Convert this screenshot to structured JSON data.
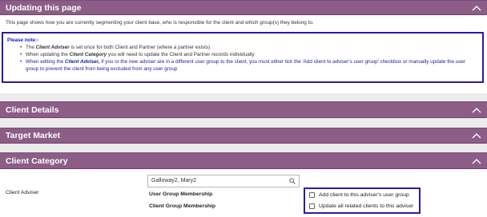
{
  "panels": {
    "updating": {
      "title": "Updating this page"
    },
    "client_details": {
      "title": "Client Details"
    },
    "target_market": {
      "title": "Target Market"
    },
    "client_category": {
      "title": "Client Category"
    }
  },
  "intro_text": "This page shows how you are currently segmenting your client base, who is responsible for the client and which group(s) they belong to.",
  "note": {
    "title": "Please note:-",
    "item1_pre": "The ",
    "item1_em": "Client Adviser",
    "item1_post": " is set once for both Client and Partner (where a partner exists)",
    "item2_pre": "When updating the ",
    "item2_em": "Client Category",
    "item2_post": " you will need to update the Client and Partner records individually",
    "item3_pre": "When editing the ",
    "item3_em": "Client Adviser,",
    "item3_post": " if you or the new adviser are in a different user group to the client, you must either tick the 'Add client to adviser's user group' checkbox or manually update the user group to prevent the client from being excluded from any user group"
  },
  "client_category": {
    "adviser_label": "Client Adviser",
    "adviser_value": "Galloway2, Mary2",
    "user_group_label": "User Group Membership",
    "client_group_label": "Client Group Membership",
    "checkbox_add_label": "Add client to this adviser's user group",
    "checkbox_update_label": "Update all related clients to this adviser"
  },
  "colors": {
    "header": "#8b5d87",
    "note_border": "#2e1a9e",
    "note_text": "#1a1aa6"
  },
  "icons": {
    "collapse": "chevron-up-icon",
    "search": "search-icon"
  }
}
